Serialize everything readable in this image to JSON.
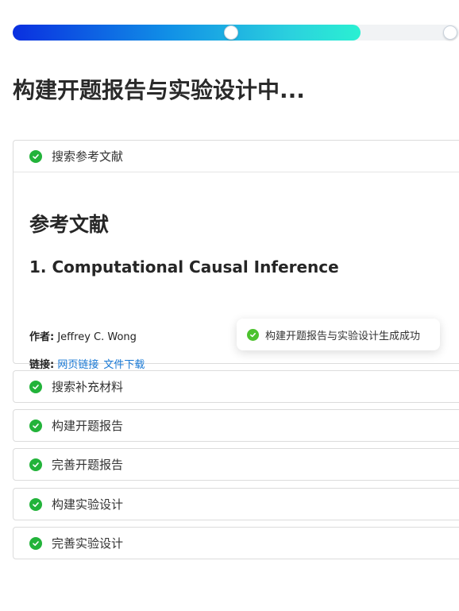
{
  "progress": {
    "percent": 78,
    "thumb1_percent": 49,
    "thumb2_percent": 98
  },
  "page_title": "构建开题报告与实验设计中...",
  "steps": [
    {
      "label": "搜索参考文献",
      "status": "done"
    },
    {
      "label": "搜索补充材料",
      "status": "done"
    },
    {
      "label": "构建开题报告",
      "status": "done"
    },
    {
      "label": "完善开题报告",
      "status": "done"
    },
    {
      "label": "构建实验设计",
      "status": "done"
    },
    {
      "label": "完善实验设计",
      "status": "done"
    }
  ],
  "references": {
    "heading": "参考文献",
    "item": {
      "title": "1. Computational Causal Inference",
      "author_label": "作者:",
      "author": "Jeffrey C. Wong",
      "links_label": "链接:",
      "web_link": "网页链接",
      "download_link": "文件下载"
    }
  },
  "toast": {
    "message": "构建开题报告与实验设计生成成功"
  },
  "colors": {
    "accent_green": "#22b33a",
    "link_blue": "#1677d4"
  }
}
